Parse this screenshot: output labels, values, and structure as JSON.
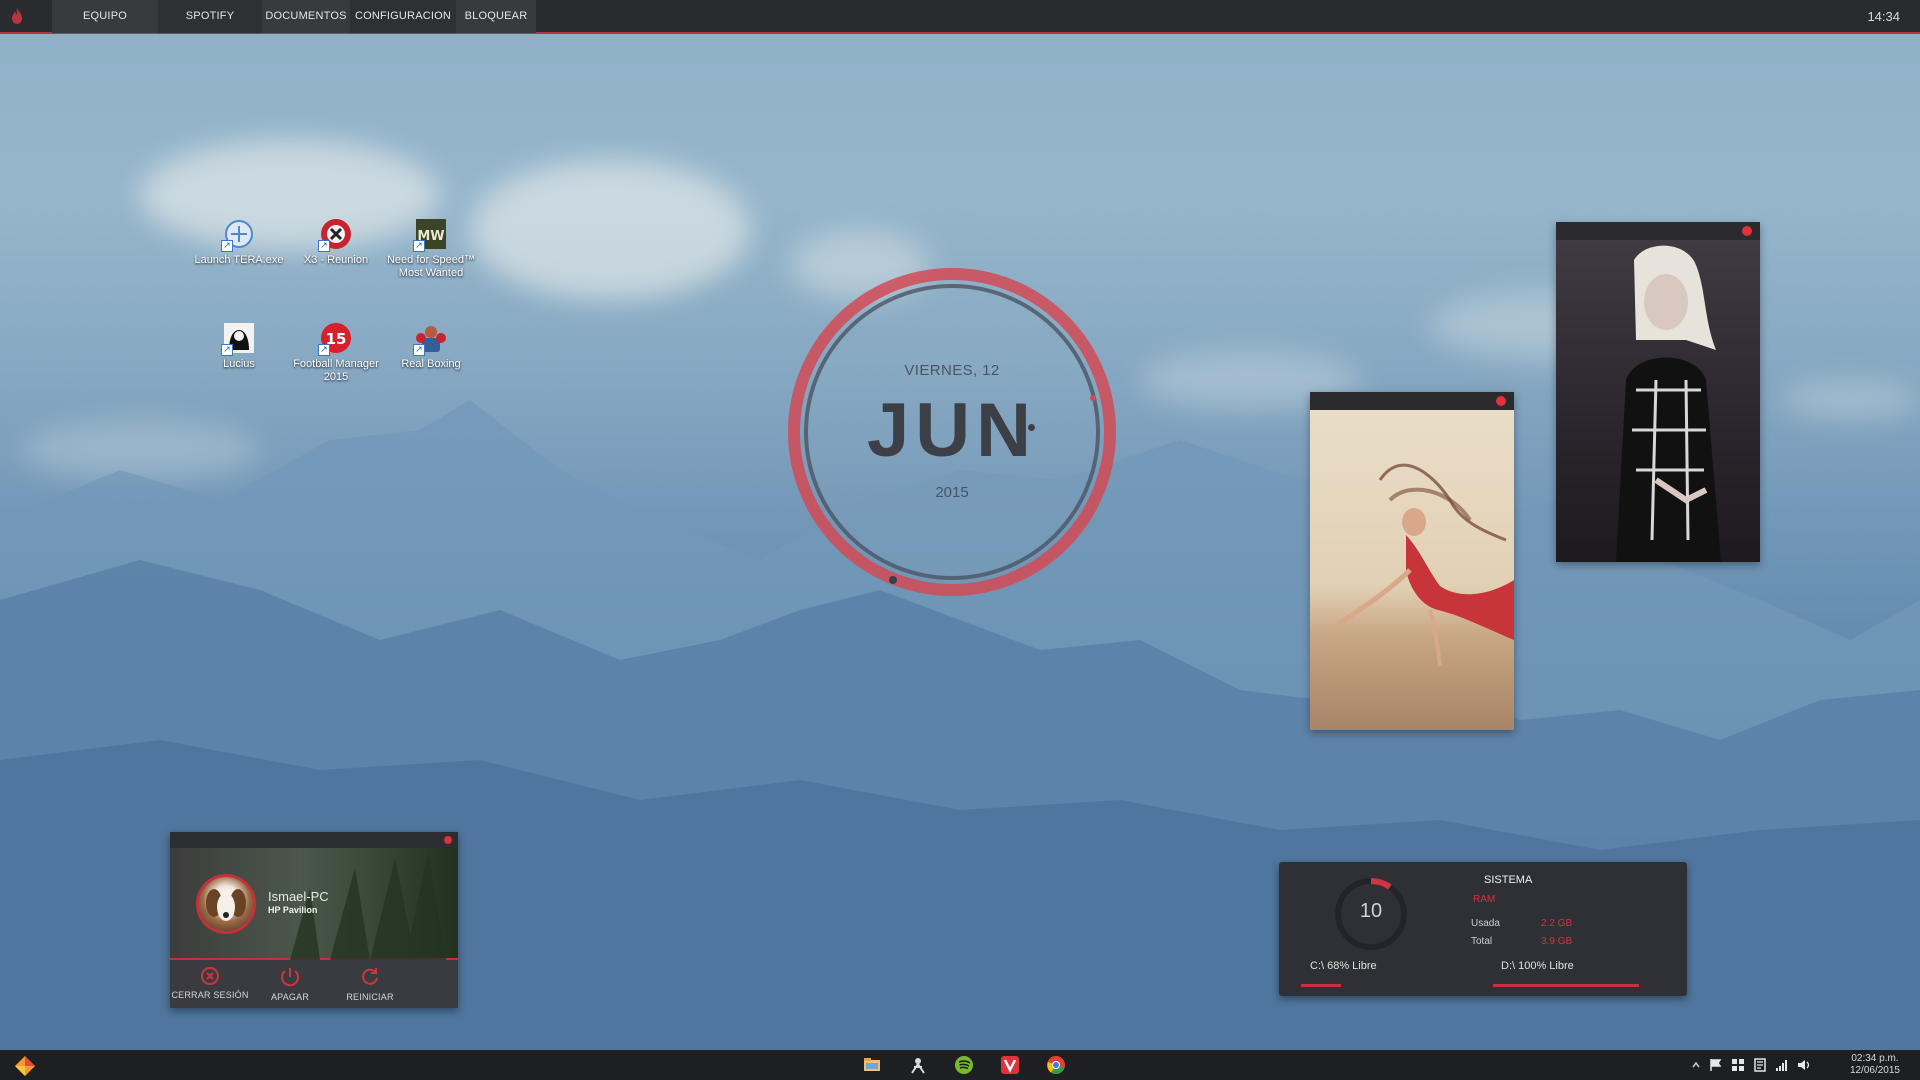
{
  "top_bar": {
    "menu": [
      "EQUIPO",
      "SPOTIFY",
      "DOCUMENTOS",
      "CONFIGURACION",
      "BLOQUEAR"
    ],
    "clock": "14:34",
    "accent_color": "#b7343d"
  },
  "desktop_icons": [
    {
      "label": "Launch TERA.exe",
      "icon": "tera-launcher-icon"
    },
    {
      "label": "X3 - Reunion",
      "icon": "x3-reunion-icon"
    },
    {
      "label": "Need for Speed™ Most Wanted",
      "icon": "nfs-most-wanted-icon"
    },
    {
      "label": "Lucius",
      "icon": "lucius-icon"
    },
    {
      "label": "Football Manager 2015",
      "icon": "football-manager-icon"
    },
    {
      "label": "Real Boxing",
      "icon": "real-boxing-icon"
    }
  ],
  "date_widget": {
    "day": "VIERNES, 12",
    "month": "JUN",
    "year": "2015",
    "ring_color": "#d24a55"
  },
  "user_widget": {
    "user_name": "Ismael-PC",
    "device": "HP Pavilion",
    "actions": [
      {
        "label": "CERRAR SESIÓN",
        "icon": "logout-icon"
      },
      {
        "label": "APAGAR",
        "icon": "power-icon"
      },
      {
        "label": "REINICIAR",
        "icon": "restart-icon"
      }
    ]
  },
  "system_widget": {
    "title": "SISTEMA",
    "ram_label": "RAM",
    "used_label": "Usada",
    "used_value": "2.2 GB",
    "total_label": "Total",
    "total_value": "3.9 GB",
    "gauge_value": "10",
    "drive_c": "C:\\ 68% Libre",
    "drive_d": "D:\\ 100% Libre"
  },
  "taskbar": {
    "apps": [
      "file-explorer-icon",
      "game-app-icon",
      "spotify-icon",
      "vivaldi-icon",
      "chrome-icon"
    ],
    "tray": [
      "flag-icon",
      "windows-icon",
      "network-adapter-icon",
      "signal-icon",
      "volume-icon"
    ],
    "time": "02:34 p.m.",
    "date": "12/06/2015"
  }
}
